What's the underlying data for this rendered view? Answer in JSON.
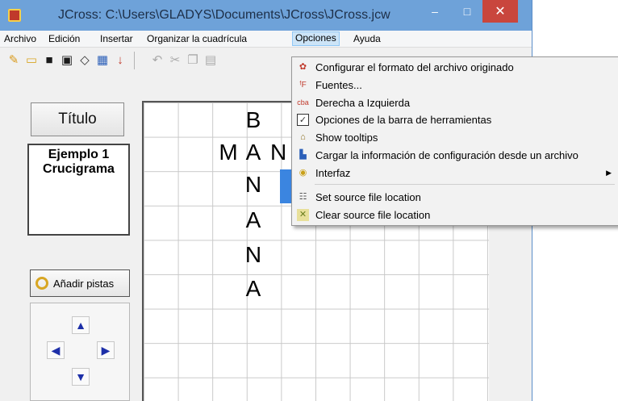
{
  "window": {
    "title": "JCross: C:\\Users\\GLADYS\\Documents\\JCross\\JCross.jcw",
    "minimize": "–",
    "maximize": "□",
    "close": "✕"
  },
  "menubar": {
    "items": [
      "Archivo",
      "Edición",
      "Insertar",
      "Organizar la cuadrícula",
      "Opciones",
      "Ayuda"
    ]
  },
  "toolbar": {
    "icons": [
      "new-icon",
      "open-icon",
      "save-icon",
      "save-as-icon",
      "eraser-icon",
      "grid-icon",
      "down-arrow-icon",
      "undo-icon",
      "cut-icon",
      "copy-icon",
      "paste-icon"
    ]
  },
  "left_panel": {
    "title_button": "Título",
    "title_text_line1": "Ejemplo 1",
    "title_text_line2": "Crucigrama",
    "add_clues_button": "Añadir pistas"
  },
  "grid": {
    "letters": [
      "B",
      "M",
      "A",
      "N",
      "N",
      "A",
      "N",
      "A"
    ]
  },
  "dropdown": {
    "items": [
      "Configurar el formato del archivo originado",
      "Fuentes...",
      "Derecha a Izquierda",
      "Opciones de la barra de herramientas",
      "Show tooltips",
      "Cargar la información de configuración desde un archivo",
      "Interfaz",
      "Set source file location",
      "Clear source file location"
    ],
    "icon_texts": [
      "ᶠF",
      "cba"
    ]
  },
  "colors": {
    "titlebar": "#6ea2d9",
    "close_button": "#c9463d",
    "selected_cell": "#3b85e0",
    "arrow_blue": "#1d2fa8"
  }
}
